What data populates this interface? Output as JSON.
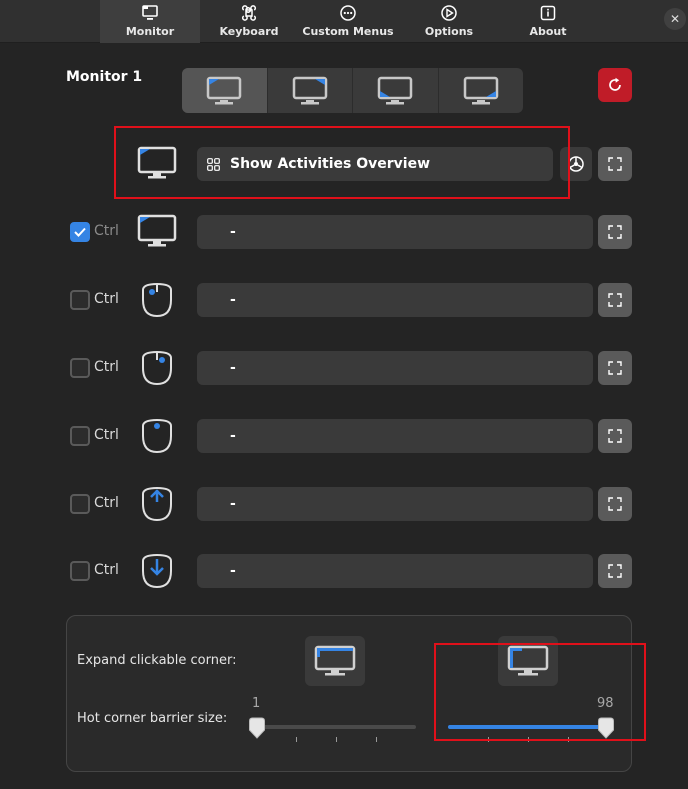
{
  "tabs": [
    {
      "label": "Monitor",
      "icon": "monitor-icon",
      "active": true
    },
    {
      "label": "Keyboard",
      "icon": "command-key-icon",
      "active": false
    },
    {
      "label": "Custom Menus",
      "icon": "more-horizontal-icon",
      "active": false
    },
    {
      "label": "Options",
      "icon": "settings-wheel-icon",
      "active": false
    },
    {
      "label": "About",
      "icon": "info-icon",
      "active": false
    }
  ],
  "monitor": {
    "title": "Monitor 1",
    "corner_selector": [
      "top-left",
      "top-right",
      "bottom-left",
      "bottom-right"
    ],
    "selected_corner": "top-left"
  },
  "rows": [
    {
      "modifier": "",
      "checked": false,
      "icon": "monitor-corner-icon",
      "action": "Show Activities Overview",
      "action_icon": "app-grid-icon",
      "has_settings": true
    },
    {
      "modifier": "Ctrl",
      "checked": true,
      "disabled": true,
      "icon": "monitor-corner-icon",
      "action": "-",
      "has_settings": false
    },
    {
      "modifier": "Ctrl",
      "checked": false,
      "icon": "mouse-left-click-icon",
      "action": "-",
      "has_settings": false
    },
    {
      "modifier": "Ctrl",
      "checked": false,
      "icon": "mouse-right-click-icon",
      "action": "-",
      "has_settings": false
    },
    {
      "modifier": "Ctrl",
      "checked": false,
      "icon": "mouse-middle-click-icon",
      "action": "-",
      "has_settings": false
    },
    {
      "modifier": "Ctrl",
      "checked": false,
      "icon": "scroll-up-icon",
      "action": "-",
      "has_settings": false
    },
    {
      "modifier": "Ctrl",
      "checked": false,
      "icon": "scroll-down-icon",
      "action": "-",
      "has_settings": false
    }
  ],
  "bottom": {
    "expand_label": "Expand clickable corner:",
    "barrier_label": "Hot corner barrier size:",
    "slider_h": {
      "value": 1,
      "min": 1,
      "max": 98,
      "label": "1"
    },
    "slider_v": {
      "value": 98,
      "min": 1,
      "max": 98,
      "label": "98"
    }
  },
  "colors": {
    "accent": "#3584e4",
    "reset": "#c01c28",
    "highlight_box": "#e0101a"
  }
}
